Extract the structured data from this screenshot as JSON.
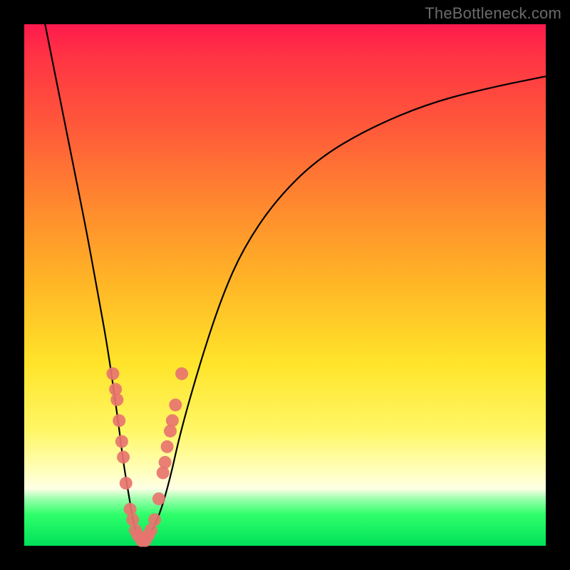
{
  "watermark": "TheBottleneck.com",
  "chart_data": {
    "type": "line",
    "title": "",
    "xlabel": "",
    "ylabel": "",
    "xlim": [
      0,
      100
    ],
    "ylim": [
      0,
      100
    ],
    "curve": {
      "name": "bottleneck-curve",
      "x": [
        4,
        6,
        8,
        10,
        12,
        14,
        16,
        18,
        19,
        20,
        21,
        22,
        23,
        24,
        26,
        28,
        30,
        34,
        38,
        42,
        48,
        56,
        66,
        78,
        90,
        100
      ],
      "y": [
        100,
        90,
        80,
        70,
        60,
        49,
        38,
        24,
        16,
        10,
        4,
        1,
        1,
        2,
        6,
        13,
        22,
        36,
        48,
        57,
        66,
        74,
        80,
        85,
        88,
        90
      ]
    },
    "scatter": {
      "name": "sample-points",
      "color": "#e8746f",
      "points": [
        {
          "x": 17.0,
          "y": 33
        },
        {
          "x": 17.5,
          "y": 30
        },
        {
          "x": 17.8,
          "y": 28
        },
        {
          "x": 18.2,
          "y": 24
        },
        {
          "x": 18.7,
          "y": 20
        },
        {
          "x": 19.0,
          "y": 17
        },
        {
          "x": 19.5,
          "y": 12
        },
        {
          "x": 20.3,
          "y": 7
        },
        {
          "x": 20.8,
          "y": 5
        },
        {
          "x": 21.3,
          "y": 3
        },
        {
          "x": 21.8,
          "y": 2
        },
        {
          "x": 22.5,
          "y": 1
        },
        {
          "x": 23.2,
          "y": 1
        },
        {
          "x": 23.8,
          "y": 2
        },
        {
          "x": 24.3,
          "y": 3
        },
        {
          "x": 25.0,
          "y": 5
        },
        {
          "x": 25.8,
          "y": 9
        },
        {
          "x": 26.6,
          "y": 14
        },
        {
          "x": 27.0,
          "y": 16
        },
        {
          "x": 27.4,
          "y": 19
        },
        {
          "x": 28.0,
          "y": 22
        },
        {
          "x": 28.4,
          "y": 24
        },
        {
          "x": 29.0,
          "y": 27
        },
        {
          "x": 30.2,
          "y": 33
        }
      ]
    }
  }
}
